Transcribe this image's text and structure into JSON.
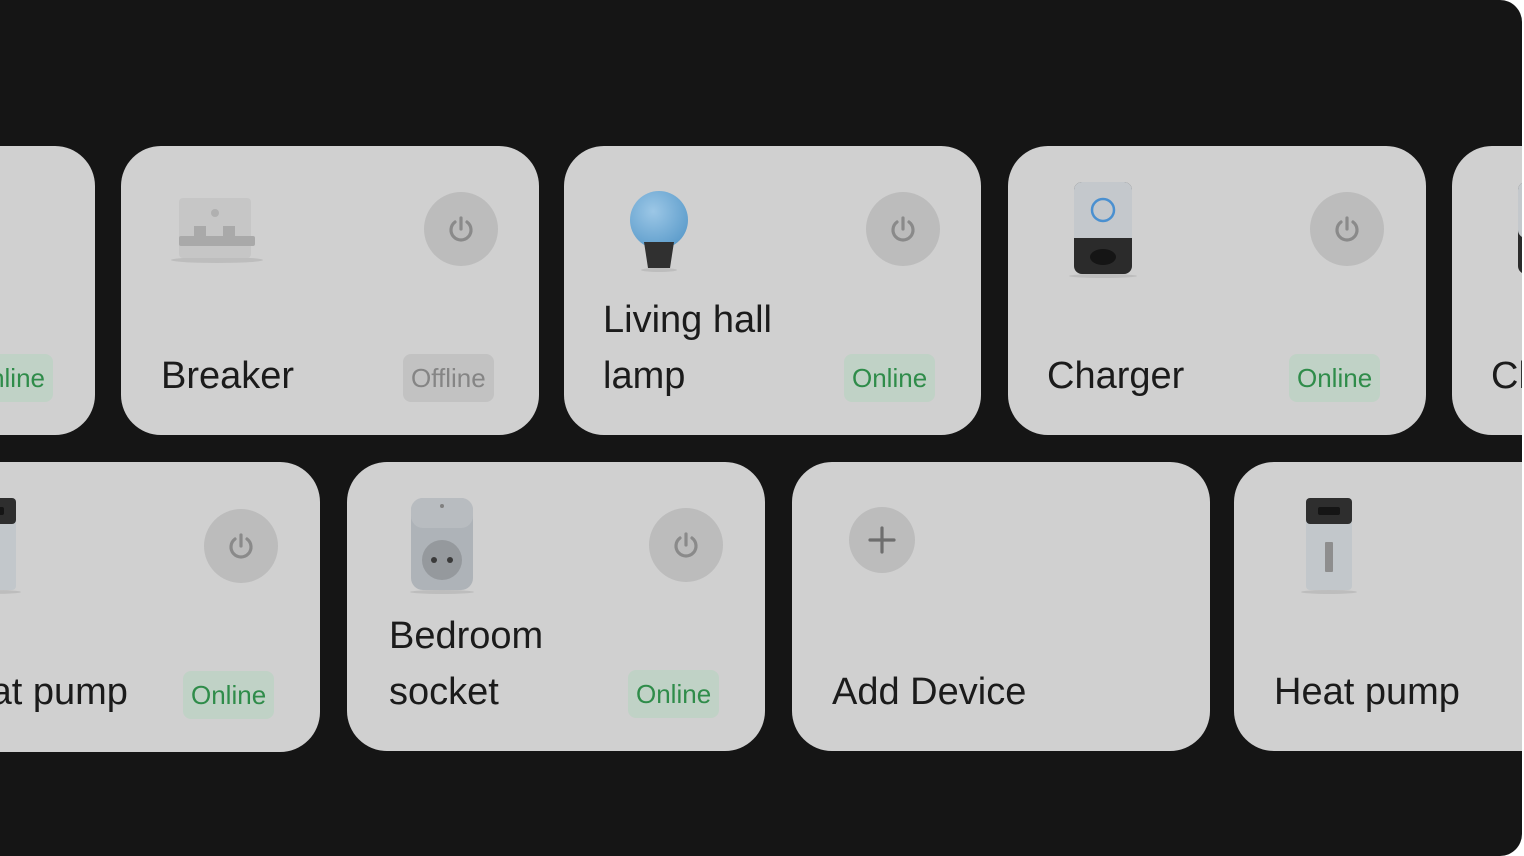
{
  "colors": {
    "background": "#151515",
    "card": "#d0d0d0",
    "online_text": "#2f8c4a",
    "online_bg": "#c0d2c6",
    "offline_text": "#858585",
    "offline_bg": "#c2c2c2"
  },
  "row1": {
    "partial_left": {
      "status": "Online"
    },
    "breaker": {
      "name": "Breaker",
      "status": "Offline",
      "icon": "breaker-icon"
    },
    "living_hall_lamp": {
      "name_line1": "Living hall",
      "name_line2": "lamp",
      "status": "Online",
      "icon": "bulb-icon"
    },
    "charger": {
      "name": "Charger",
      "status": "Online",
      "icon": "charger-icon"
    },
    "partial_right": {
      "name": "Charger"
    }
  },
  "row2": {
    "heat_pump_left": {
      "name": "Heat pump",
      "status": "Online",
      "icon": "heat-pump-icon"
    },
    "bedroom_socket": {
      "name_line1": "Bedroom",
      "name_line2": "socket",
      "status": "Online",
      "icon": "socket-icon"
    },
    "add_device": {
      "label": "Add Device",
      "icon": "plus-icon"
    },
    "heat_pump_right": {
      "name": "Heat pump",
      "icon": "heat-pump-icon"
    }
  }
}
